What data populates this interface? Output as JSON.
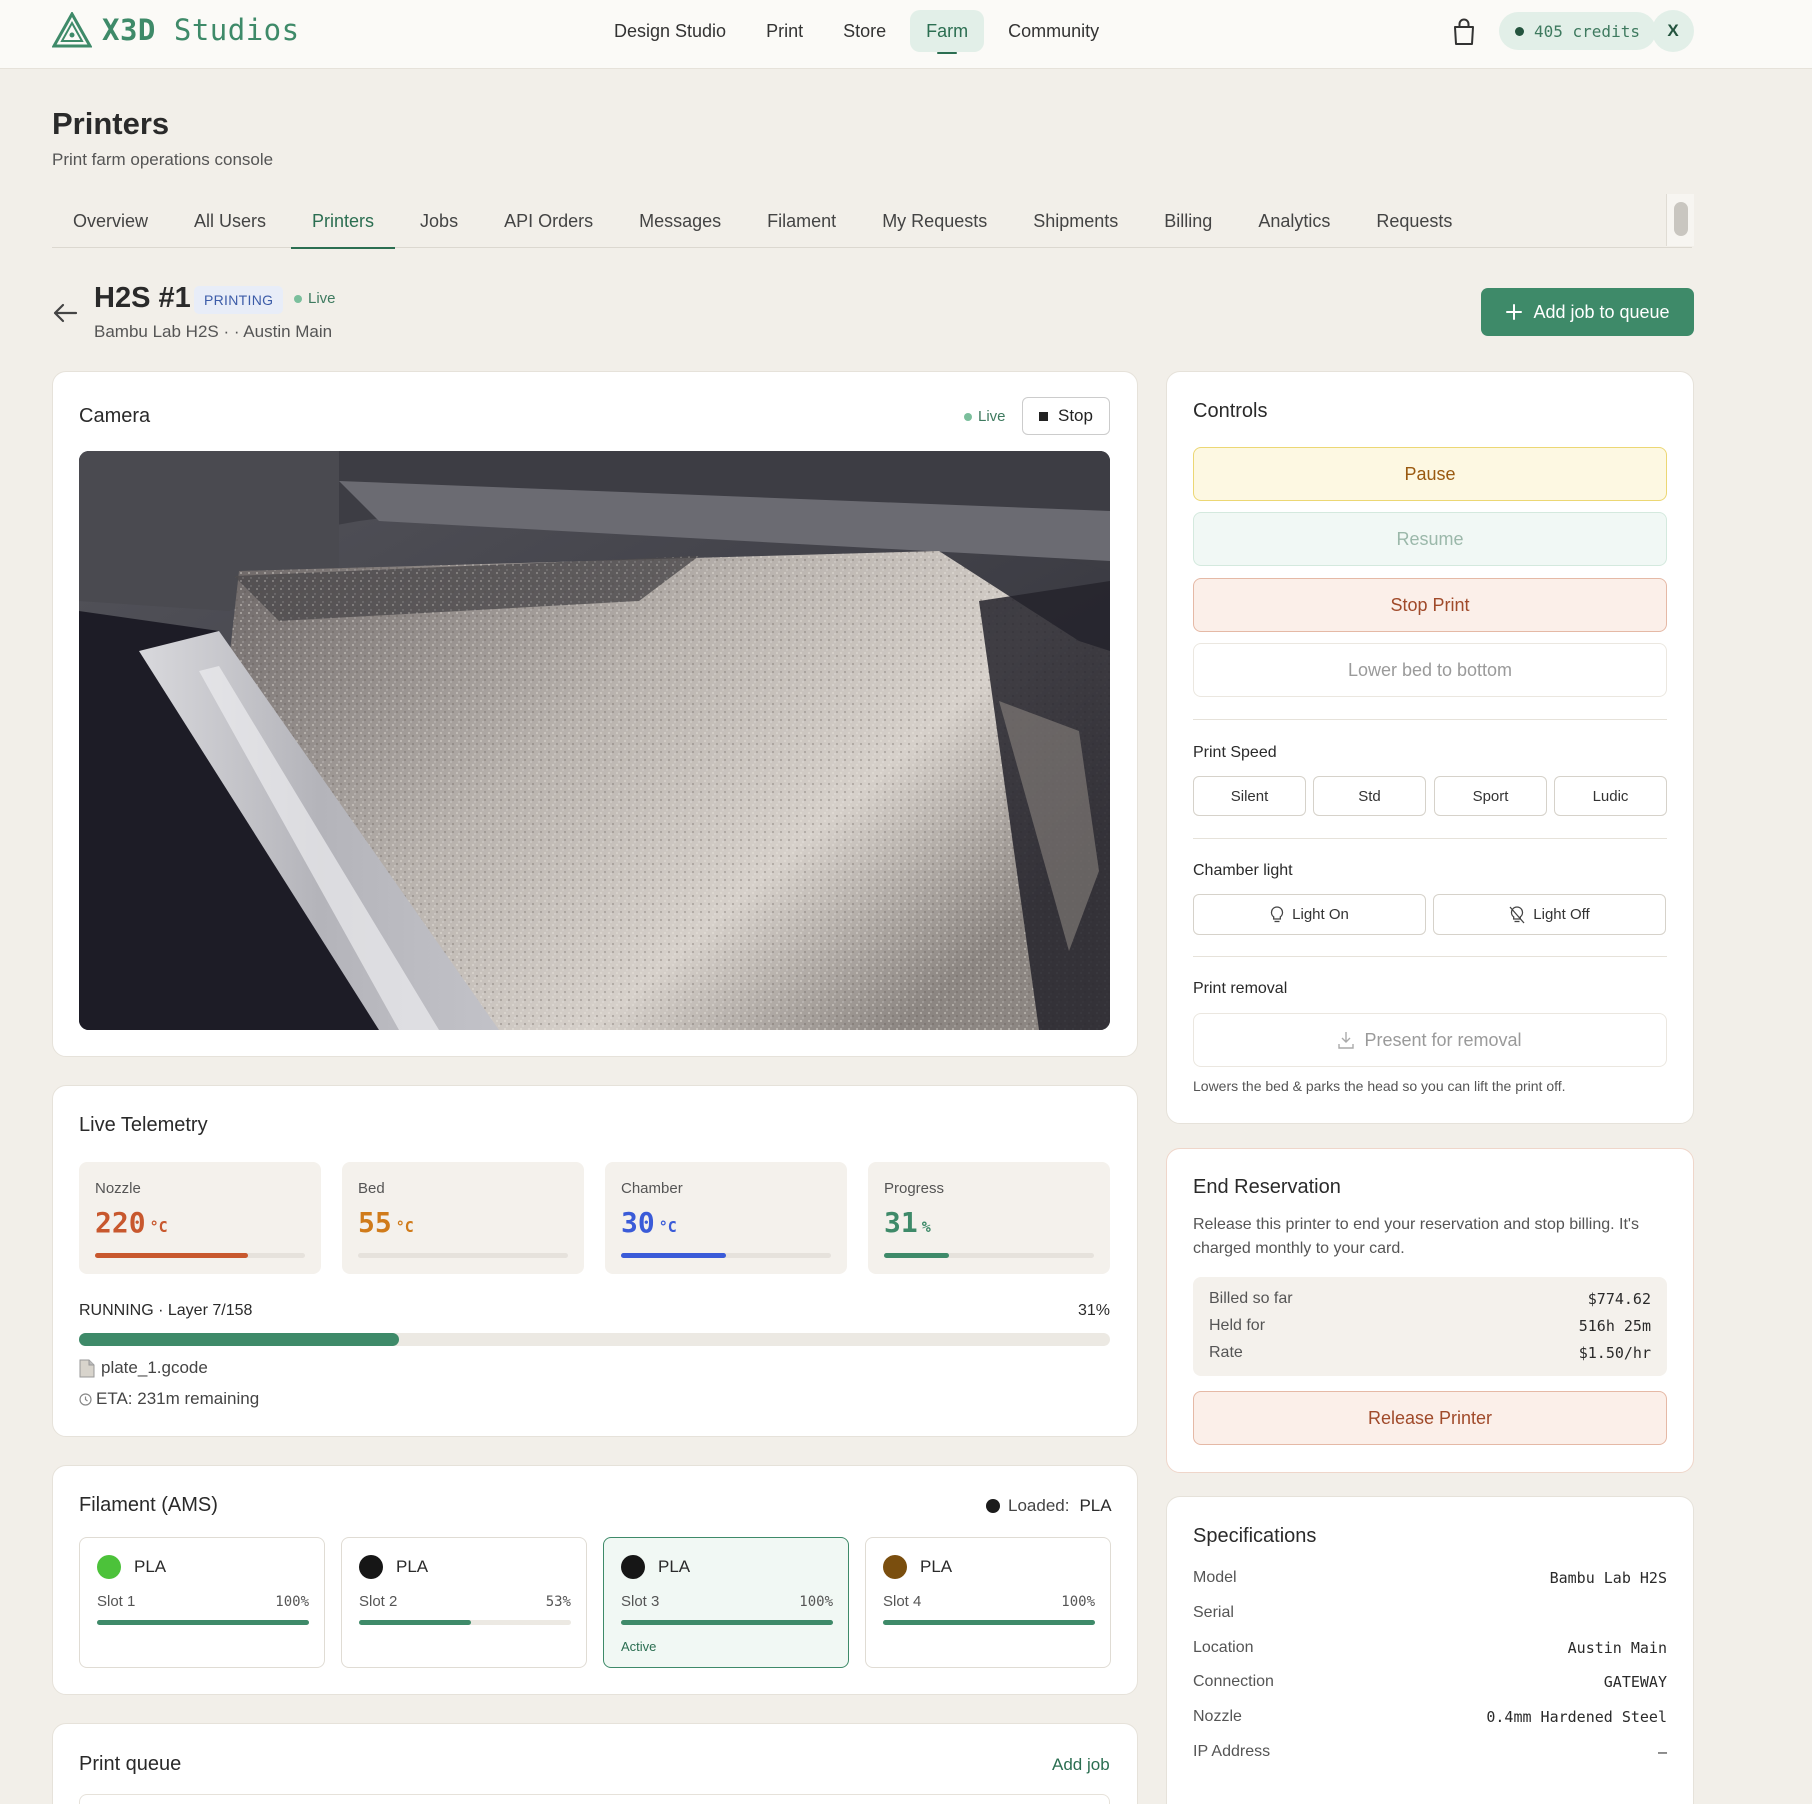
{
  "brand": {
    "name_bold": "X3D",
    "name_light": "Studios",
    "accent": "#3e8a69"
  },
  "nav": {
    "items": [
      "Design Studio",
      "Print",
      "Store",
      "Farm",
      "Community"
    ],
    "active": "Farm"
  },
  "header_right": {
    "cart_icon": "shopping-bag-icon",
    "credits": "405 credits",
    "avatar_initial": "X"
  },
  "page": {
    "title": "Printers",
    "subtitle": "Print farm operations console"
  },
  "tabs": {
    "items": [
      "Overview",
      "All Users",
      "Printers",
      "Jobs",
      "API Orders",
      "Messages",
      "Filament",
      "My Requests",
      "Shipments",
      "Billing",
      "Analytics",
      "Requests"
    ],
    "active": "Printers"
  },
  "printer": {
    "name": "H2S #1",
    "status": "PRINTING",
    "live": "Live",
    "meta": "Bambu Lab H2S · · Austin Main",
    "add_job_label": "Add job to queue"
  },
  "camera": {
    "title": "Camera",
    "live": "Live",
    "stop_label": "Stop"
  },
  "telemetry": {
    "title": "Live Telemetry",
    "metrics": [
      {
        "label": "Nozzle",
        "value": "220",
        "unit": "°C",
        "fraction": 0.73,
        "color": "#c8582e"
      },
      {
        "label": "Bed",
        "value": "55",
        "unit": "°C",
        "fraction": 0,
        "color": "#d07b1a"
      },
      {
        "label": "Chamber",
        "value": "30",
        "unit": "°C",
        "fraction": 0.5,
        "color": "#3a5bd8"
      },
      {
        "label": "Progress",
        "value": "31",
        "unit": "%",
        "fraction": 0.31,
        "color": "#3e8a69"
      }
    ],
    "run_status": "RUNNING · Layer 7/158",
    "run_percent": "31%",
    "run_fraction": 0.31,
    "file": "plate_1.gcode",
    "eta": "ETA: 231m remaining"
  },
  "filament": {
    "title": "Filament (AMS)",
    "loaded_label": "Loaded:",
    "loaded_value": "PLA",
    "slots": [
      {
        "material": "PLA",
        "slot": "Slot 1",
        "percent": "100%",
        "fraction": 1.0,
        "color": "#4cc23a",
        "active": false
      },
      {
        "material": "PLA",
        "slot": "Slot 2",
        "percent": "53%",
        "fraction": 0.53,
        "color": "#161616",
        "active": false
      },
      {
        "material": "PLA",
        "slot": "Slot 3",
        "percent": "100%",
        "fraction": 1.0,
        "color": "#161616",
        "active": true,
        "active_label": "Active"
      },
      {
        "material": "PLA",
        "slot": "Slot 4",
        "percent": "100%",
        "fraction": 1.0,
        "color": "#7a4e0e",
        "active": false
      }
    ]
  },
  "queue": {
    "title": "Print queue",
    "add_label": "Add job"
  },
  "controls": {
    "title": "Controls",
    "pause": "Pause",
    "resume": "Resume",
    "stop_print": "Stop Print",
    "lower_bed": "Lower bed to bottom",
    "speed_label": "Print Speed",
    "speeds": [
      "Silent",
      "Std",
      "Sport",
      "Ludic"
    ],
    "light_label": "Chamber light",
    "light_on": "Light On",
    "light_off": "Light Off",
    "removal_label": "Print removal",
    "removal_button": "Present for removal",
    "removal_note": "Lowers the bed & parks the head so you can lift the print off."
  },
  "reservation": {
    "title": "End Reservation",
    "desc": "Release this printer to end your reservation and stop billing. It's charged monthly to your card.",
    "rows": [
      {
        "label": "Billed so far",
        "value": "$774.62"
      },
      {
        "label": "Held for",
        "value": "516h 25m"
      },
      {
        "label": "Rate",
        "value": "$1.50/hr"
      }
    ],
    "release_label": "Release Printer"
  },
  "specs": {
    "title": "Specifications",
    "rows": [
      {
        "label": "Model",
        "value": "Bambu Lab H2S"
      },
      {
        "label": "Serial",
        "value": ""
      },
      {
        "label": "Location",
        "value": "Austin Main"
      },
      {
        "label": "Connection",
        "value": "GATEWAY"
      },
      {
        "label": "Nozzle",
        "value": "0.4mm Hardened Steel"
      },
      {
        "label": "IP Address",
        "value": "—"
      }
    ]
  }
}
